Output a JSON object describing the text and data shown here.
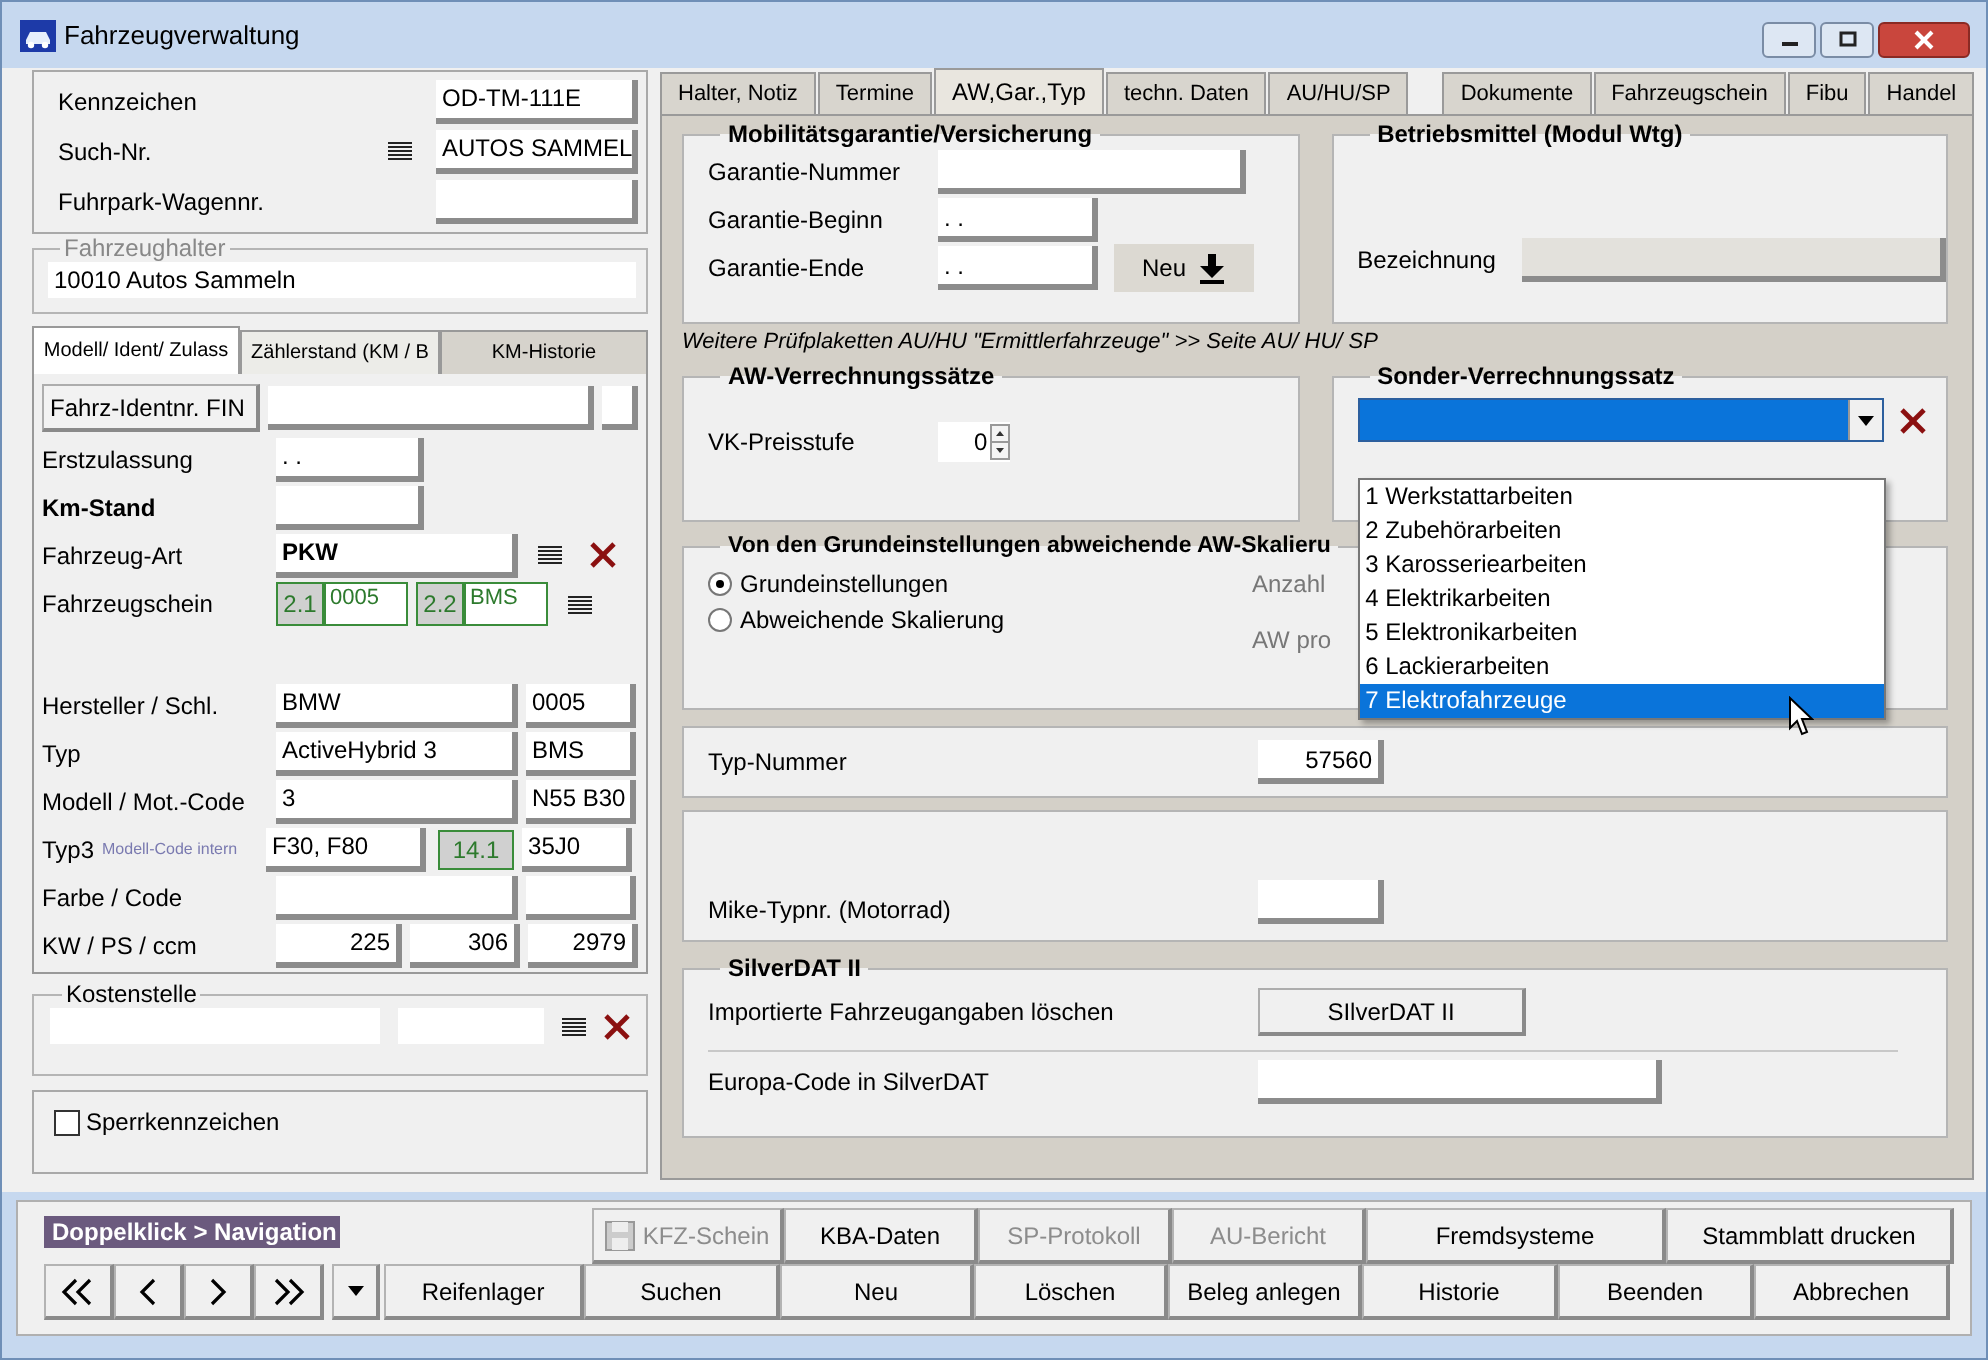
{
  "window": {
    "title": "Fahrzeugverwaltung"
  },
  "vehicle_fields": [
    {
      "kind": "plain",
      "label": "Kennzeichen",
      "value": "OD-TM-111E"
    },
    {
      "kind": "lookup",
      "label": "Such-Nr.",
      "value": "AUTOS SAMMEL"
    },
    {
      "kind": "plain",
      "label": "Fuhrpark-Wagennr."
    }
  ],
  "owner": {
    "legend": "Fahrzeughalter",
    "value": "10010 Autos Sammeln"
  },
  "left_tabs": [
    {
      "label": "Modell/ Ident/ Zulass",
      "selected": true
    },
    {
      "label": "Zählerstand (KM / B",
      "selected": false
    },
    {
      "label": "KM-Historie",
      "selected": false
    }
  ],
  "left_rows": [
    {
      "kind": "fin",
      "button": "Fahrz-Identnr. FIN"
    },
    {
      "kind": "single",
      "label": "Erstzulassung",
      "value": ". .",
      "bold": false
    },
    {
      "kind": "single",
      "label": "Km-Stand",
      "bold": true
    },
    {
      "kind": "lookup",
      "label": "Fahrzeug-Art",
      "value": "PKW"
    },
    {
      "kind": "schein",
      "label": "Fahrzeugschein",
      "codes": [
        {
          "code": "2.1",
          "value": "0005"
        },
        {
          "code": "2.2",
          "value": "BMS"
        }
      ]
    },
    {
      "kind": "pair",
      "label": "Hersteller / Schl.",
      "values": [
        "BMW",
        "0005"
      ]
    },
    {
      "kind": "pair",
      "label": "Typ",
      "values": [
        "ActiveHybrid 3",
        "BMS"
      ]
    },
    {
      "kind": "pair",
      "label": "Modell / Mot.-Code",
      "values": [
        "3",
        "N55 B30"
      ]
    },
    {
      "kind": "typ3",
      "label": "Typ3",
      "hint": "Modell-Code intern",
      "values": [
        "F30, F80",
        "35J0"
      ],
      "badge": "14.1"
    },
    {
      "kind": "pair",
      "label": "Farbe / Code"
    },
    {
      "kind": "triple",
      "label": "KW / PS / ccm",
      "values": [
        "225",
        "306",
        "2979"
      ]
    }
  ],
  "cost_center": {
    "legend": "Kostenstelle"
  },
  "lock_plate": {
    "label": "Sperrkennzeichen",
    "checked": false
  },
  "right_tabs": [
    {
      "label": "Halter, Notiz",
      "selected": false
    },
    {
      "label": "Termine",
      "selected": false
    },
    {
      "label": "AW,Gar.,Typ",
      "selected": true
    },
    {
      "label": "techn. Daten",
      "selected": false
    },
    {
      "label": "AU/HU/SP",
      "selected": false
    },
    {
      "label": "Dokumente",
      "selected": false
    },
    {
      "label": "Fahrzeugschein",
      "selected": false
    },
    {
      "label": "Fibu",
      "selected": false
    },
    {
      "label": "Handel",
      "selected": false
    }
  ],
  "guarantee": {
    "legend": "Mobilitätsgarantie/Versicherung",
    "fields": [
      {
        "label": "Garantie-Nummer"
      },
      {
        "label": "Garantie-Beginn",
        "value": ". ."
      },
      {
        "label": "Garantie-Ende",
        "value": ". ."
      }
    ],
    "button": "Neu"
  },
  "supplies": {
    "legend": "Betriebsmittel (Modul Wtg)",
    "label": "Bezeichnung"
  },
  "note": "Weitere Prüfplaketten AU/HU \"Ermittlerfahrzeuge\" >> Seite AU/ HU/ SP",
  "aw_rates": {
    "legend": "AW-Verrechnungssätze",
    "label": "VK-Preisstufe",
    "value": "0"
  },
  "special_rate": {
    "legend": "Sonder-Verrechnungssatz",
    "expanded": true,
    "options": [
      {
        "label": "1 Werkstattarbeiten",
        "selected": false
      },
      {
        "label": "2 Zubehörarbeiten",
        "selected": false
      },
      {
        "label": "3 Karosseriearbeiten",
        "selected": false
      },
      {
        "label": "4 Elektrikarbeiten",
        "selected": false
      },
      {
        "label": "5 Elektronikarbeiten",
        "selected": false
      },
      {
        "label": "6 Lackierarbeiten",
        "selected": false
      },
      {
        "label": "7 Elektrofahrzeuge",
        "selected": true
      }
    ]
  },
  "scaling": {
    "legend": "Von den Grundeinstellungen abweichende AW-Skalieru",
    "options": [
      {
        "label": "Grundeinstellungen",
        "selected": true
      },
      {
        "label": "Abweichende Skalierung",
        "selected": false
      }
    ],
    "labels": [
      "Anzahl",
      "AW pro"
    ]
  },
  "type_number": {
    "label": "Typ-Nummer",
    "value": "57560"
  },
  "mike": {
    "label": "Mike-Typnr. (Motorrad)"
  },
  "silverdat": {
    "legend": "SilverDAT II",
    "rows": [
      {
        "kind": "button",
        "label": "Importierte Fahrzeugangaben löschen",
        "button": "SIlverDAT II"
      },
      {
        "kind": "field",
        "label": "Europa-Code in SilverDAT"
      }
    ]
  },
  "navigation": {
    "label": "Doppelklick > Navigation"
  },
  "actions_top": [
    {
      "label": "KFZ-Schein",
      "disabled": true,
      "icon": true
    },
    {
      "label": "KBA-Daten",
      "disabled": false
    },
    {
      "label": "SP-Protokoll",
      "disabled": true
    },
    {
      "label": "AU-Bericht",
      "disabled": true
    },
    {
      "label": "Fremdsysteme",
      "disabled": false
    },
    {
      "label": "Stammblatt drucken",
      "disabled": false
    }
  ],
  "actions_bottom": [
    {
      "label": "Reifenlager",
      "disabled": false
    },
    {
      "label": "Suchen",
      "disabled": false
    },
    {
      "label": "Neu",
      "disabled": false
    },
    {
      "label": "Löschen",
      "disabled": false
    },
    {
      "label": "Beleg anlegen",
      "disabled": false
    },
    {
      "label": "Historie",
      "disabled": false
    },
    {
      "label": "Beenden",
      "disabled": false
    },
    {
      "label": "Abbrechen",
      "disabled": false
    }
  ]
}
